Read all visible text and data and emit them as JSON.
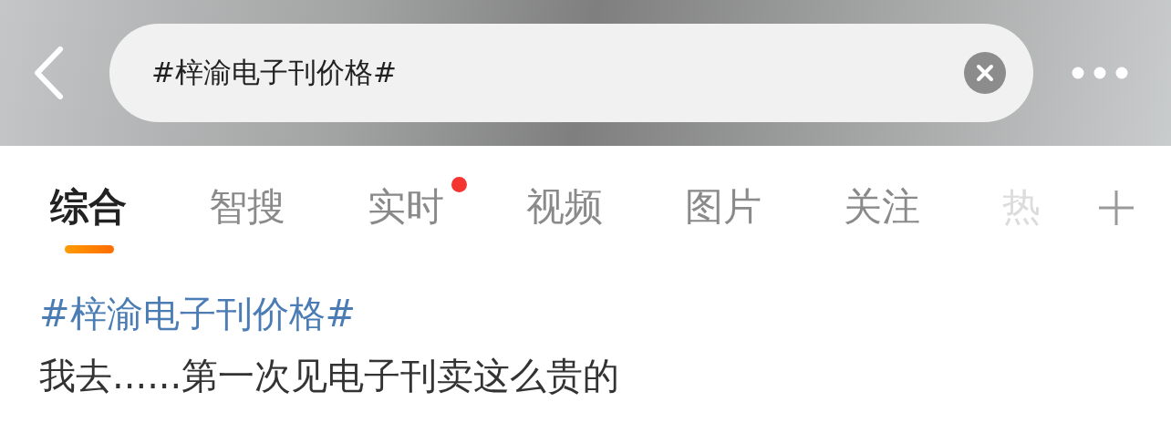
{
  "search": {
    "value": "#梓渝电子刊价格#"
  },
  "tabs": [
    {
      "label": "综合",
      "selected": true,
      "dot": false
    },
    {
      "label": "智搜",
      "selected": false,
      "dot": false
    },
    {
      "label": "实时",
      "selected": false,
      "dot": true
    },
    {
      "label": "视频",
      "selected": false,
      "dot": false
    },
    {
      "label": "图片",
      "selected": false,
      "dot": false
    },
    {
      "label": "关注",
      "selected": false,
      "dot": false
    },
    {
      "label": "热",
      "selected": false,
      "dot": false
    }
  ],
  "result": {
    "topic": "#梓渝电子刊价格#",
    "text": "我去......第一次见电子刊卖这么贵的"
  }
}
